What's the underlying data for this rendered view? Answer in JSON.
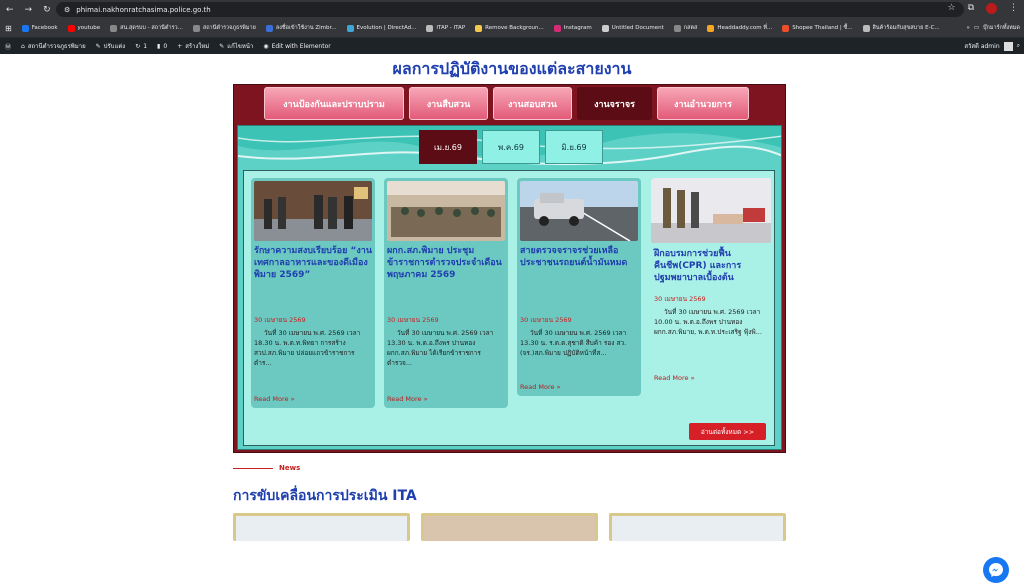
{
  "browser": {
    "url": "phimai.nakhonratchasima.police.go.th",
    "bookmarks": [
      {
        "label": "Facebook",
        "color": "#1877f2"
      },
      {
        "label": "youtube",
        "color": "#ff0000"
      },
      {
        "label": "สน.สุดรบบ - สถานีตำรว...",
        "color": "#888888"
      },
      {
        "label": "สถานีตำรวจภูธรพิมาย",
        "color": "#888888"
      },
      {
        "label": "ลงชื่อเข้าใช้งาน Zimbr...",
        "color": "#3a6fd8"
      },
      {
        "label": "Evolution | DirectAd...",
        "color": "#3fa7d6"
      },
      {
        "label": "ITAP - ITAP",
        "color": "#bbbbbb"
      },
      {
        "label": "Remove Backgroun...",
        "color": "#f2c94c"
      },
      {
        "label": "Instagram",
        "color": "#d62976"
      },
      {
        "label": "Untitled Document",
        "color": "#cccccc"
      },
      {
        "label": "กสตส",
        "color": "#888888"
      },
      {
        "label": "Headdaddy.com ที่...",
        "color": "#f5a623"
      },
      {
        "label": "Shopee Thailand | ซื้...",
        "color": "#ee4d2d"
      },
      {
        "label": "สินค้าร้อมกับสุขสบาย E-C...",
        "color": "#bbbbbb"
      }
    ],
    "more_label": "»",
    "all_bookmarks_label": "บุ๊กมาร์กทั้งหมด"
  },
  "wpbar": {
    "items": [
      "สถานีตำรวจภูธรพิมาย",
      "ปรับแต่ง",
      "1",
      "0",
      "สร้างใหม่",
      "แก้ไขหน้า",
      "Edit with Elementor"
    ],
    "greeting": "สวัสดี admin"
  },
  "section": {
    "title": "ผลการปฏิบัติงานของแต่ละสายงาน",
    "tabs": [
      {
        "label": "งานป้องกันและปราบปราม",
        "active": false
      },
      {
        "label": "งานสืบสวน",
        "active": false
      },
      {
        "label": "งานสอบสวน",
        "active": false
      },
      {
        "label": "งานจราจร",
        "active": true
      },
      {
        "label": "งานอำนวยการ",
        "active": false
      }
    ],
    "months": [
      {
        "label": "เม.ย.69",
        "active": true
      },
      {
        "label": "พ.ค.69",
        "active": false
      },
      {
        "label": "มิ.ย.69",
        "active": false
      }
    ],
    "cards": [
      {
        "title": "รักษาความสงบเรียบร้อย “งานเทศกาลอาหารและของดีเมืองพิมาย 2569”",
        "date": "30 เมษายน 2569",
        "excerpt": "วันที่ 30 เมษายน พ.ศ. 2569 เวลา 18.30 น. พ.ต.ท.พิทยา การสร้าง สวป.สภ.พิมาย ปล่อยแถวข้าราชการตำร...",
        "more": "Read More »"
      },
      {
        "title": "ผกก.สภ.พิมาย ประชุมข้าราชการตำรวจประจำเดือน พฤษภาคม 2569",
        "date": "30 เมษายน 2569",
        "excerpt": "วันที่ 30 เมษายน พ.ศ. 2569 เวลา 13.30 น. พ.ต.อ.ถึงพร ปานทอง ผกก.สภ.พิมาย ได้เรียกข้าราชการตำรวจ...",
        "more": "Read More »"
      },
      {
        "title": "สายตรวจจราจรช่วยเหลือประชาชนรถยนต์น้ำมันหมด",
        "date": "30 เมษายน 2569",
        "excerpt": "วันที่ 30 เมษายน พ.ศ. 2569 เวลา 13.30 น. ร.ต.ต.สุชาติ สืบค้า รอง สว.(จร.)สภ.พิมาย ปฏิบัติหน้าที่ส...",
        "more": "Read More »"
      },
      {
        "title": "ฝึกอบรมการช่วยฟื้นคืนชีพ(CPR) และการปฐมพยาบาลเบื้องต้น",
        "date": "30 เมษายน 2569",
        "excerpt": "วันที่ 30 เมษายน พ.ศ. 2569 เวลา 10.00 น. พ.ต.อ.ถึงพร ปานทอง ผกก.สภ.พิมาย, พ.ต.ท.ประเสริฐ ฟุ้งพิ...",
        "more": "Read More »"
      }
    ],
    "read_all": "อ่านต่อทั้งหมด >>"
  },
  "news": {
    "label": "News",
    "title": "การขับเคลื่อนการประเมิน ITA"
  },
  "colors": {
    "accent_blue": "#1f3fae",
    "panel_red": "#7d1420",
    "teal": "#5ed1c7",
    "date_red": "#c81e1e"
  }
}
